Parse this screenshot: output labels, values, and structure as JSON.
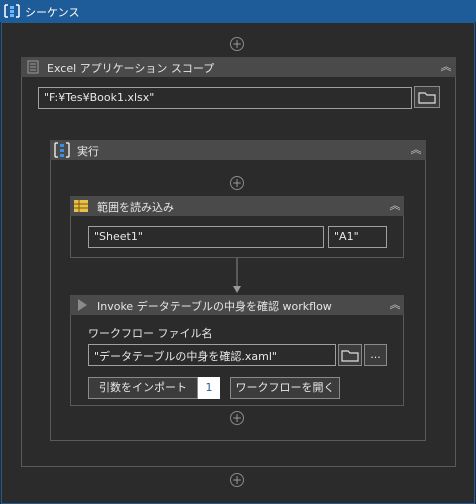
{
  "sequence": {
    "title": "シーケンス"
  },
  "excel_scope": {
    "title": "Excel アプリケーション スコープ",
    "path_value": "\"F:¥Tes¥Book1.xlsx\""
  },
  "execute": {
    "title": "実行"
  },
  "read_range": {
    "title": "範囲を読み込み",
    "sheet_value": "\"Sheet1\"",
    "range_value": "\"A1\""
  },
  "invoke": {
    "title": "Invoke データテーブルの中身を確認 workflow",
    "file_label": "ワークフロー ファイル名",
    "file_value": "\"データテーブルの中身を確認.xaml\"",
    "more_label": "...",
    "import_label": "引数をインポート",
    "arg_count": "1",
    "open_label": "ワークフローを開く"
  },
  "icons": {
    "plus": "+",
    "collapse": "︽"
  },
  "colors": {
    "accent": "#1e5c99",
    "header_bg": "#4a4a4a",
    "canvas_bg": "#2b2b2b",
    "count_badge_text": "#1e5c99"
  }
}
